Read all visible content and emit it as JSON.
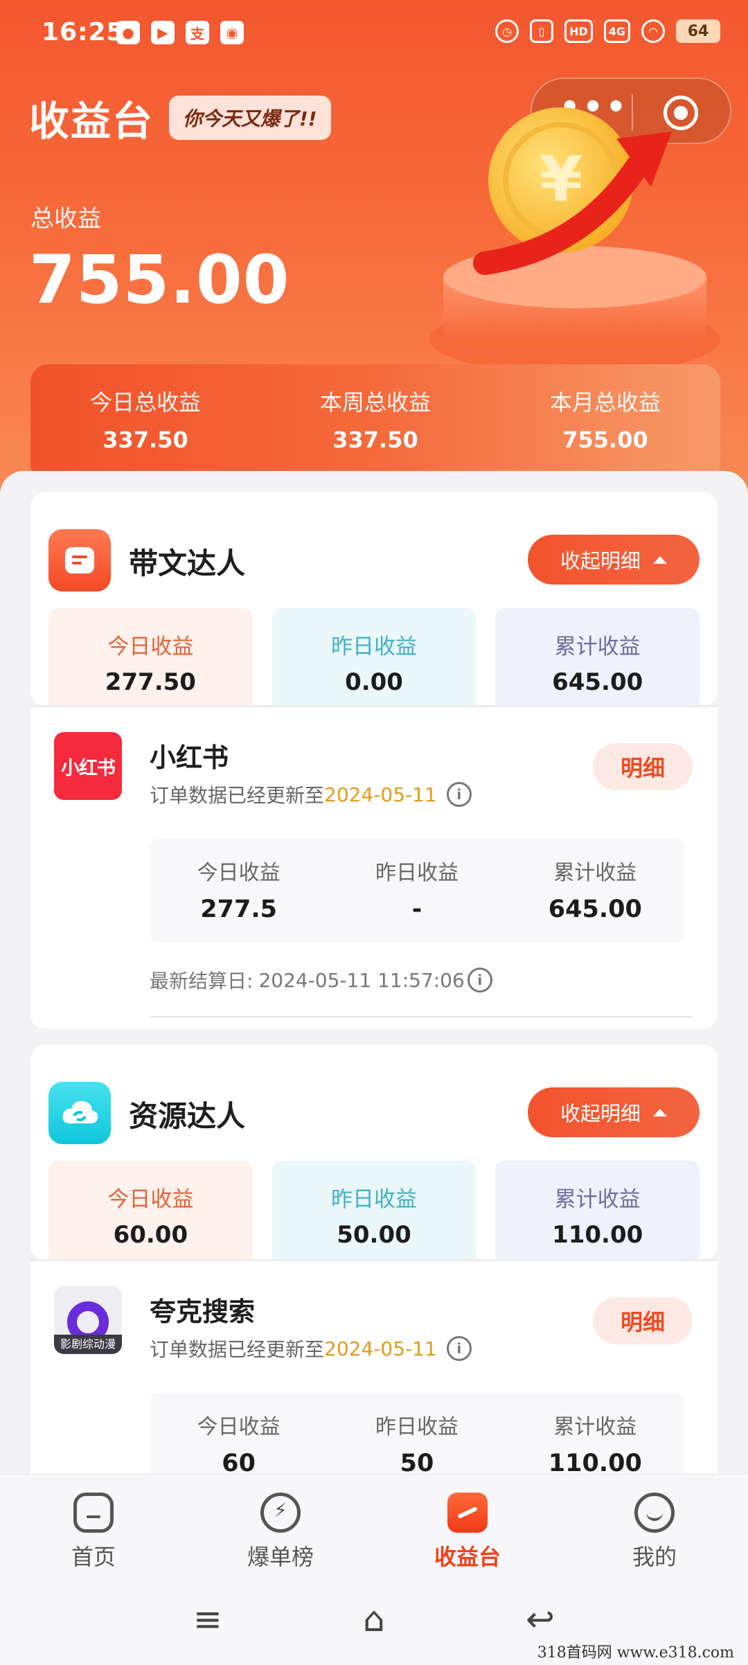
{
  "status_bar": {
    "time": "16:25",
    "apps": [
      "wechat-icon",
      "play-icon",
      "alipay-icon",
      "map-icon"
    ],
    "network": "4G",
    "battery": "64"
  },
  "header": {
    "title": "收益台",
    "tagline": "你今天又爆了!!"
  },
  "total": {
    "label": "总收益",
    "value": "755.00"
  },
  "summary": [
    {
      "label": "今日总收益",
      "value": "337.50"
    },
    {
      "label": "本周总收益",
      "value": "337.50"
    },
    {
      "label": "本月总收益",
      "value": "755.00"
    }
  ],
  "sections": [
    {
      "title": "带文达人",
      "collapse_label": "收起明细",
      "tiles": [
        {
          "label": "今日收益",
          "value": "277.50"
        },
        {
          "label": "昨日收益",
          "value": "0.00"
        },
        {
          "label": "累计收益",
          "value": "645.00"
        }
      ],
      "platform": {
        "name": "小红书",
        "logo_text": "小红书",
        "update_prefix": "订单数据已经更新至",
        "update_date": "2024-05-11",
        "detail_label": "明细",
        "stats": [
          {
            "label": "今日收益",
            "value": "277.5"
          },
          {
            "label": "昨日收益",
            "value": "-"
          },
          {
            "label": "累计收益",
            "value": "645.00"
          }
        ],
        "settle_label": "最新结算日:",
        "settle_time": "2024-05-11 11:57:06"
      }
    },
    {
      "title": "资源达人",
      "collapse_label": "收起明细",
      "tiles": [
        {
          "label": "今日收益",
          "value": "60.00"
        },
        {
          "label": "昨日收益",
          "value": "50.00"
        },
        {
          "label": "累计收益",
          "value": "110.00"
        }
      ],
      "platform": {
        "name": "夸克搜索",
        "logo_tag": "影剧综动漫",
        "update_prefix": "订单数据已经更新至",
        "update_date": "2024-05-11",
        "detail_label": "明细",
        "stats": [
          {
            "label": "今日收益",
            "value": "60"
          },
          {
            "label": "昨日收益",
            "value": "50"
          },
          {
            "label": "累计收益",
            "value": "110.00"
          }
        ]
      }
    }
  ],
  "bottom_nav": [
    {
      "label": "首页",
      "icon": "home-icon"
    },
    {
      "label": "爆单榜",
      "icon": "bolt-icon"
    },
    {
      "label": "收益台",
      "icon": "earnings-icon",
      "active": true
    },
    {
      "label": "我的",
      "icon": "profile-icon"
    }
  ],
  "watermark": "318首码网 www.e318.com",
  "colors": {
    "brand": "#f3572f",
    "accent_date": "#e29a1a",
    "active_nav": "#f0421c"
  }
}
